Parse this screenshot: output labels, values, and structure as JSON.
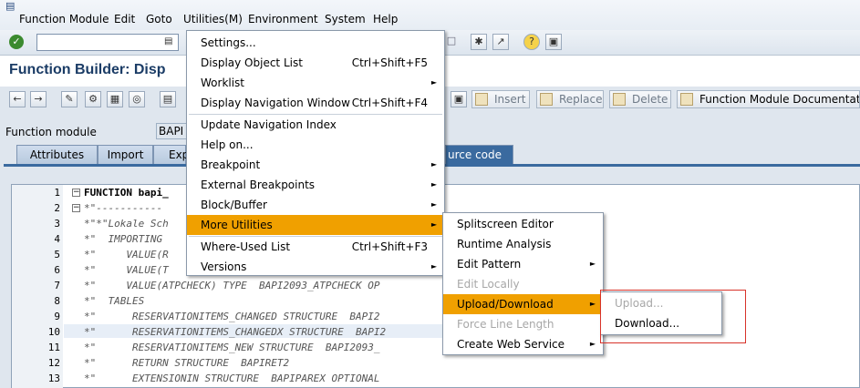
{
  "menubar": [
    "Function Module",
    "Edit",
    "Goto",
    "Utilities(M)",
    "Environment",
    "System",
    "Help"
  ],
  "page_title": "Function Builder: Disp",
  "app_buttons": [
    "Insert",
    "Replace",
    "Delete",
    "Function Module Documentatio"
  ],
  "function_module": {
    "label": "Function module",
    "value": "BAPI"
  },
  "tabs": [
    "Attributes",
    "Import",
    "Exp",
    "urce code"
  ],
  "code_lines": [
    {
      "n": "1",
      "text": "FUNCTION bapi_"
    },
    {
      "n": "2",
      "text": "*\"-----------"
    },
    {
      "n": "3",
      "text": "*\"*\"Lokale Sch"
    },
    {
      "n": "4",
      "text": "*\"  IMPORTING"
    },
    {
      "n": "5",
      "text": "*\"     VALUE(R"
    },
    {
      "n": "6",
      "text": "*\"     VALUE(T"
    },
    {
      "n": "7",
      "text": "*\"     VALUE(ATPCHECK) TYPE  BAPI2093_ATPCHECK OP"
    },
    {
      "n": "8",
      "text": "*\"  TABLES"
    },
    {
      "n": "9",
      "text": "*\"      RESERVATIONITEMS_CHANGED STRUCTURE  BAPI2"
    },
    {
      "n": "10",
      "text": "*\"      RESERVATIONITEMS_CHANGEDX STRUCTURE  BAPI2"
    },
    {
      "n": "11",
      "text": "*\"      RESERVATIONITEMS_NEW STRUCTURE  BAPI2093_"
    },
    {
      "n": "12",
      "text": "*\"      RETURN STRUCTURE  BAPIRET2"
    },
    {
      "n": "13",
      "text": "*\"      EXTENSIONIN STRUCTURE  BAPIPAREX OPTIONAL"
    }
  ],
  "utilities_menu": [
    {
      "label": "Settings...",
      "shortcut": "",
      "arrow": false
    },
    {
      "label": "Display Object List",
      "shortcut": "Ctrl+Shift+F5",
      "arrow": false
    },
    {
      "label": "Worklist",
      "shortcut": "",
      "arrow": true
    },
    {
      "label": "Display Navigation Window",
      "shortcut": "Ctrl+Shift+F4",
      "arrow": false
    },
    {
      "label": "Update Navigation Index",
      "shortcut": "",
      "arrow": false
    },
    {
      "label": "Help on...",
      "shortcut": "",
      "arrow": false
    },
    {
      "label": "Breakpoint",
      "shortcut": "",
      "arrow": true
    },
    {
      "label": "External Breakpoints",
      "shortcut": "",
      "arrow": true
    },
    {
      "label": "Block/Buffer",
      "shortcut": "",
      "arrow": true
    },
    {
      "label": "More Utilities",
      "shortcut": "",
      "arrow": true
    },
    {
      "label": "Where-Used List",
      "shortcut": "Ctrl+Shift+F3",
      "arrow": false
    },
    {
      "label": "Versions",
      "shortcut": "",
      "arrow": true
    }
  ],
  "more_utilities_menu": [
    {
      "label": "Splitscreen Editor",
      "arrow": false
    },
    {
      "label": "Runtime Analysis",
      "arrow": false
    },
    {
      "label": "Edit Pattern",
      "arrow": true
    },
    {
      "label": "Edit Locally",
      "arrow": false
    },
    {
      "label": "Upload/Download",
      "arrow": true
    },
    {
      "label": "Force Line Length",
      "arrow": false
    },
    {
      "label": "Create Web Service",
      "arrow": true
    }
  ],
  "upload_menu": [
    {
      "label": "Upload..."
    },
    {
      "label": "Download..."
    }
  ],
  "colors": {
    "highlight": "#f0a000",
    "tab_active": "#3a6a9f",
    "title": "#1b3c66",
    "annotation": "#d8332a"
  }
}
